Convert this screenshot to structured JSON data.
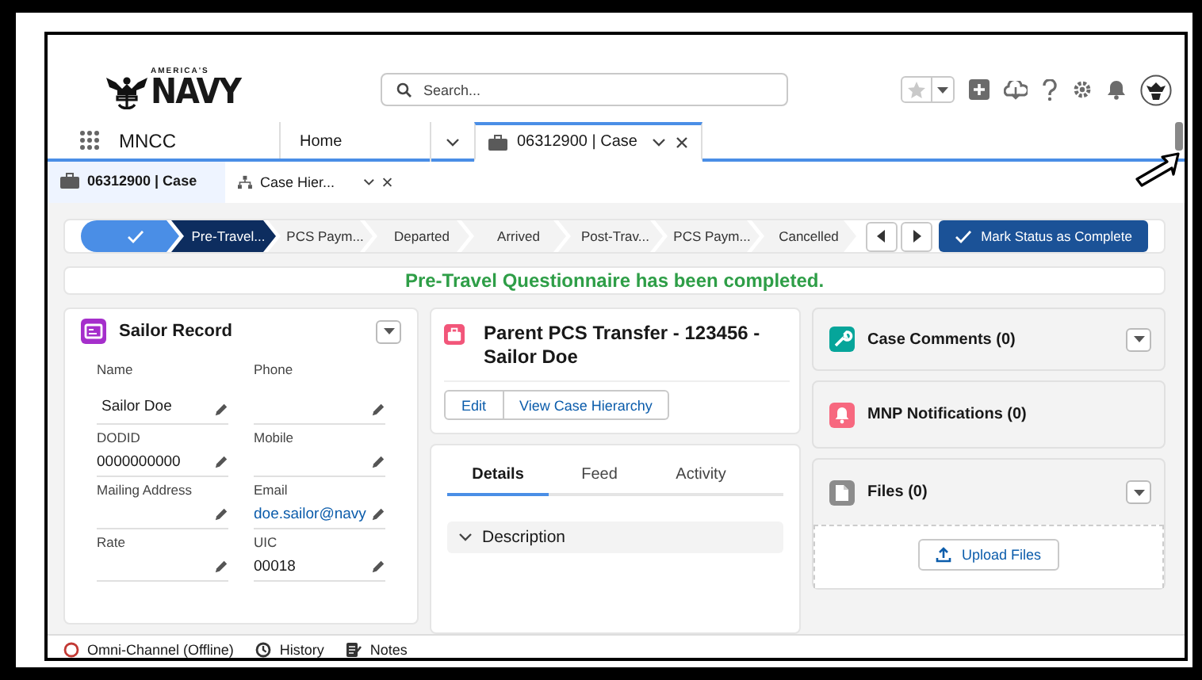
{
  "header": {
    "logo": {
      "tagline": "AMERICA'S",
      "name": "NAVY"
    },
    "search": {
      "placeholder": "Search..."
    }
  },
  "nav": {
    "app_name": "MNCC",
    "tabs": [
      {
        "label": "Home",
        "selected": false,
        "kind": "home"
      },
      {
        "label": "06312900 | Case",
        "selected": true,
        "kind": "record"
      }
    ]
  },
  "subtabs": [
    {
      "label": "06312900 | Case",
      "selected": true,
      "kind": "case"
    },
    {
      "label": "Case Hier...",
      "selected": false,
      "kind": "hierarchy"
    }
  ],
  "path": {
    "stages": [
      {
        "completed": true,
        "selected": false
      },
      {
        "label": "Pre-Travel...",
        "completed": false,
        "selected": true
      },
      {
        "label": "PCS Paym...",
        "completed": false,
        "selected": false
      },
      {
        "label": "Departed",
        "completed": false,
        "selected": false
      },
      {
        "label": "Arrived",
        "completed": false,
        "selected": false
      },
      {
        "label": "Post-Trav...",
        "completed": false,
        "selected": false
      },
      {
        "label": "PCS Paym...",
        "completed": false,
        "selected": false
      },
      {
        "label": "Cancelled",
        "completed": false,
        "selected": false
      }
    ],
    "button": "Mark Status as Complete"
  },
  "message": "Pre-Travel Questionnaire has been completed.",
  "sailor_record": {
    "title": "Sailor Record",
    "fields": [
      {
        "label": "Name",
        "value": "Sailor Doe",
        "kind": "text"
      },
      {
        "label": "Phone"
      },
      {
        "label": "DODID",
        "value": "0000000000",
        "kind": "text"
      },
      {
        "label": "Mobile"
      },
      {
        "label": "Mailing Address"
      },
      {
        "label": "Email",
        "value": "doe.sailor@navy",
        "kind": "link"
      },
      {
        "label": "Rate"
      },
      {
        "label": "UIC",
        "value": "00018",
        "kind": "text"
      }
    ]
  },
  "case": {
    "title": "Parent PCS Transfer - 123456 - Sailor Doe",
    "buttons": [
      "Edit",
      "View Case Hierarchy"
    ],
    "tabs": [
      {
        "label": "Details",
        "selected": true
      },
      {
        "label": "Feed",
        "selected": false
      },
      {
        "label": "Activity",
        "selected": false
      }
    ],
    "section": {
      "label": "Description",
      "expanded": true
    }
  },
  "side_cards": [
    {
      "title": "Case Comments (0)",
      "kind": "comments",
      "menu": true
    },
    {
      "title": "MNP Notifications (0)",
      "kind": "notifications",
      "menu": false
    },
    {
      "title": "Files (0)",
      "kind": "files",
      "menu": true,
      "upload_button": "Upload Files"
    }
  ],
  "utility_bar": [
    {
      "label": "Omni-Channel (Offline)",
      "kind": "omni"
    },
    {
      "label": "History",
      "kind": "history"
    },
    {
      "label": "Notes",
      "kind": "notes"
    }
  ]
}
